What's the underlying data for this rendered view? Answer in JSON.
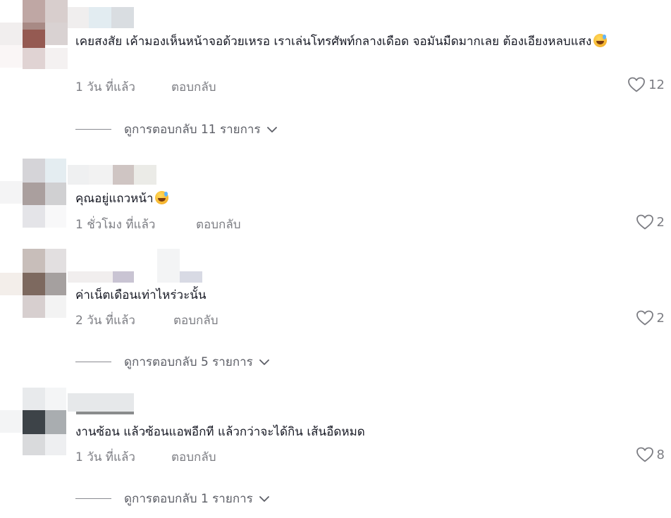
{
  "comments": [
    {
      "text": "เคยสงสัย เค้ามองเห็นหน้าจอด้วยเหรอ เราเล่นโทรศัพท์กลางเดือด จอมันมืดมากเลย ต้องเอียงหลบแสง",
      "time": "1 วัน ที่แล้ว",
      "reply_label": "ตอบกลับ",
      "likes": "12",
      "view_replies": "ดูการตอบกลับ 11 รายการ"
    },
    {
      "text": "คุณอยู่แถวหน้า",
      "time": "1 ชั่วโมง ที่แล้ว",
      "reply_label": "ตอบกลับ",
      "likes": "2",
      "view_replies": ""
    },
    {
      "text": "ค่าเน็ตเดือนเท่าไหร่วะนั้น",
      "time": "2 วัน ที่แล้ว",
      "reply_label": "ตอบกลับ",
      "likes": "2",
      "view_replies": "ดูการตอบกลับ 5 รายการ"
    },
    {
      "text": "งานซ้อน แล้วซ้อนแอพอีกที แล้วกว่าจะได้กิน เส้นอืดหมด",
      "time": "1 วัน ที่แล้ว",
      "reply_label": "ตอบกลับ",
      "likes": "8",
      "view_replies": "ดูการตอบกลับ 1 รายการ"
    }
  ],
  "icons": {
    "like": "heart-outline-icon",
    "expand": "chevron-down-icon",
    "emoji": "sweat-smile-emoji"
  },
  "colors": {
    "text": "#161823",
    "muted": "#7c7d83",
    "background": "#ffffff"
  }
}
